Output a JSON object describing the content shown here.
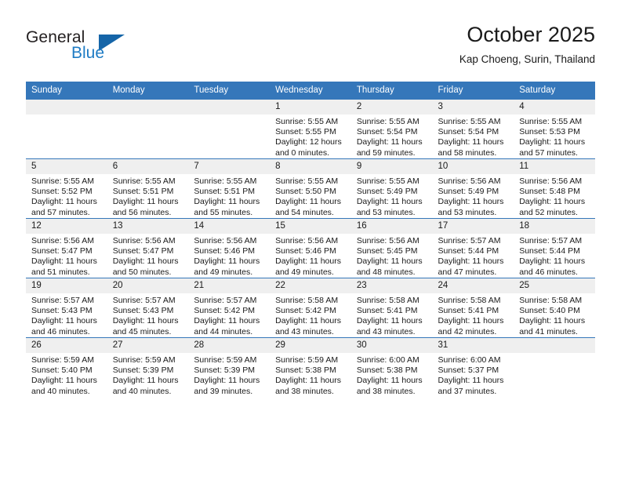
{
  "brand": {
    "name_top": "General",
    "name_bottom": "Blue",
    "accent_color": "#1e7bc4",
    "triangle_color": "#1565a8"
  },
  "header": {
    "month_title": "October 2025",
    "location": "Kap Choeng, Surin, Thailand"
  },
  "calendar": {
    "header_bg": "#3577ba",
    "daynum_bg": "#efefef",
    "weekday_headers": [
      "Sunday",
      "Monday",
      "Tuesday",
      "Wednesday",
      "Thursday",
      "Friday",
      "Saturday"
    ],
    "weeks": [
      [
        {
          "day": "",
          "empty": true,
          "sunrise": "",
          "sunset": "",
          "daylight_line1": "",
          "daylight_line2": ""
        },
        {
          "day": "",
          "empty": true,
          "sunrise": "",
          "sunset": "",
          "daylight_line1": "",
          "daylight_line2": ""
        },
        {
          "day": "",
          "empty": true,
          "sunrise": "",
          "sunset": "",
          "daylight_line1": "",
          "daylight_line2": ""
        },
        {
          "day": "1",
          "empty": false,
          "sunrise": "Sunrise: 5:55 AM",
          "sunset": "Sunset: 5:55 PM",
          "daylight_line1": "Daylight: 12 hours",
          "daylight_line2": "and 0 minutes."
        },
        {
          "day": "2",
          "empty": false,
          "sunrise": "Sunrise: 5:55 AM",
          "sunset": "Sunset: 5:54 PM",
          "daylight_line1": "Daylight: 11 hours",
          "daylight_line2": "and 59 minutes."
        },
        {
          "day": "3",
          "empty": false,
          "sunrise": "Sunrise: 5:55 AM",
          "sunset": "Sunset: 5:54 PM",
          "daylight_line1": "Daylight: 11 hours",
          "daylight_line2": "and 58 minutes."
        },
        {
          "day": "4",
          "empty": false,
          "sunrise": "Sunrise: 5:55 AM",
          "sunset": "Sunset: 5:53 PM",
          "daylight_line1": "Daylight: 11 hours",
          "daylight_line2": "and 57 minutes."
        }
      ],
      [
        {
          "day": "5",
          "empty": false,
          "sunrise": "Sunrise: 5:55 AM",
          "sunset": "Sunset: 5:52 PM",
          "daylight_line1": "Daylight: 11 hours",
          "daylight_line2": "and 57 minutes."
        },
        {
          "day": "6",
          "empty": false,
          "sunrise": "Sunrise: 5:55 AM",
          "sunset": "Sunset: 5:51 PM",
          "daylight_line1": "Daylight: 11 hours",
          "daylight_line2": "and 56 minutes."
        },
        {
          "day": "7",
          "empty": false,
          "sunrise": "Sunrise: 5:55 AM",
          "sunset": "Sunset: 5:51 PM",
          "daylight_line1": "Daylight: 11 hours",
          "daylight_line2": "and 55 minutes."
        },
        {
          "day": "8",
          "empty": false,
          "sunrise": "Sunrise: 5:55 AM",
          "sunset": "Sunset: 5:50 PM",
          "daylight_line1": "Daylight: 11 hours",
          "daylight_line2": "and 54 minutes."
        },
        {
          "day": "9",
          "empty": false,
          "sunrise": "Sunrise: 5:55 AM",
          "sunset": "Sunset: 5:49 PM",
          "daylight_line1": "Daylight: 11 hours",
          "daylight_line2": "and 53 minutes."
        },
        {
          "day": "10",
          "empty": false,
          "sunrise": "Sunrise: 5:56 AM",
          "sunset": "Sunset: 5:49 PM",
          "daylight_line1": "Daylight: 11 hours",
          "daylight_line2": "and 53 minutes."
        },
        {
          "day": "11",
          "empty": false,
          "sunrise": "Sunrise: 5:56 AM",
          "sunset": "Sunset: 5:48 PM",
          "daylight_line1": "Daylight: 11 hours",
          "daylight_line2": "and 52 minutes."
        }
      ],
      [
        {
          "day": "12",
          "empty": false,
          "sunrise": "Sunrise: 5:56 AM",
          "sunset": "Sunset: 5:47 PM",
          "daylight_line1": "Daylight: 11 hours",
          "daylight_line2": "and 51 minutes."
        },
        {
          "day": "13",
          "empty": false,
          "sunrise": "Sunrise: 5:56 AM",
          "sunset": "Sunset: 5:47 PM",
          "daylight_line1": "Daylight: 11 hours",
          "daylight_line2": "and 50 minutes."
        },
        {
          "day": "14",
          "empty": false,
          "sunrise": "Sunrise: 5:56 AM",
          "sunset": "Sunset: 5:46 PM",
          "daylight_line1": "Daylight: 11 hours",
          "daylight_line2": "and 49 minutes."
        },
        {
          "day": "15",
          "empty": false,
          "sunrise": "Sunrise: 5:56 AM",
          "sunset": "Sunset: 5:46 PM",
          "daylight_line1": "Daylight: 11 hours",
          "daylight_line2": "and 49 minutes."
        },
        {
          "day": "16",
          "empty": false,
          "sunrise": "Sunrise: 5:56 AM",
          "sunset": "Sunset: 5:45 PM",
          "daylight_line1": "Daylight: 11 hours",
          "daylight_line2": "and 48 minutes."
        },
        {
          "day": "17",
          "empty": false,
          "sunrise": "Sunrise: 5:57 AM",
          "sunset": "Sunset: 5:44 PM",
          "daylight_line1": "Daylight: 11 hours",
          "daylight_line2": "and 47 minutes."
        },
        {
          "day": "18",
          "empty": false,
          "sunrise": "Sunrise: 5:57 AM",
          "sunset": "Sunset: 5:44 PM",
          "daylight_line1": "Daylight: 11 hours",
          "daylight_line2": "and 46 minutes."
        }
      ],
      [
        {
          "day": "19",
          "empty": false,
          "sunrise": "Sunrise: 5:57 AM",
          "sunset": "Sunset: 5:43 PM",
          "daylight_line1": "Daylight: 11 hours",
          "daylight_line2": "and 46 minutes."
        },
        {
          "day": "20",
          "empty": false,
          "sunrise": "Sunrise: 5:57 AM",
          "sunset": "Sunset: 5:43 PM",
          "daylight_line1": "Daylight: 11 hours",
          "daylight_line2": "and 45 minutes."
        },
        {
          "day": "21",
          "empty": false,
          "sunrise": "Sunrise: 5:57 AM",
          "sunset": "Sunset: 5:42 PM",
          "daylight_line1": "Daylight: 11 hours",
          "daylight_line2": "and 44 minutes."
        },
        {
          "day": "22",
          "empty": false,
          "sunrise": "Sunrise: 5:58 AM",
          "sunset": "Sunset: 5:42 PM",
          "daylight_line1": "Daylight: 11 hours",
          "daylight_line2": "and 43 minutes."
        },
        {
          "day": "23",
          "empty": false,
          "sunrise": "Sunrise: 5:58 AM",
          "sunset": "Sunset: 5:41 PM",
          "daylight_line1": "Daylight: 11 hours",
          "daylight_line2": "and 43 minutes."
        },
        {
          "day": "24",
          "empty": false,
          "sunrise": "Sunrise: 5:58 AM",
          "sunset": "Sunset: 5:41 PM",
          "daylight_line1": "Daylight: 11 hours",
          "daylight_line2": "and 42 minutes."
        },
        {
          "day": "25",
          "empty": false,
          "sunrise": "Sunrise: 5:58 AM",
          "sunset": "Sunset: 5:40 PM",
          "daylight_line1": "Daylight: 11 hours",
          "daylight_line2": "and 41 minutes."
        }
      ],
      [
        {
          "day": "26",
          "empty": false,
          "sunrise": "Sunrise: 5:59 AM",
          "sunset": "Sunset: 5:40 PM",
          "daylight_line1": "Daylight: 11 hours",
          "daylight_line2": "and 40 minutes."
        },
        {
          "day": "27",
          "empty": false,
          "sunrise": "Sunrise: 5:59 AM",
          "sunset": "Sunset: 5:39 PM",
          "daylight_line1": "Daylight: 11 hours",
          "daylight_line2": "and 40 minutes."
        },
        {
          "day": "28",
          "empty": false,
          "sunrise": "Sunrise: 5:59 AM",
          "sunset": "Sunset: 5:39 PM",
          "daylight_line1": "Daylight: 11 hours",
          "daylight_line2": "and 39 minutes."
        },
        {
          "day": "29",
          "empty": false,
          "sunrise": "Sunrise: 5:59 AM",
          "sunset": "Sunset: 5:38 PM",
          "daylight_line1": "Daylight: 11 hours",
          "daylight_line2": "and 38 minutes."
        },
        {
          "day": "30",
          "empty": false,
          "sunrise": "Sunrise: 6:00 AM",
          "sunset": "Sunset: 5:38 PM",
          "daylight_line1": "Daylight: 11 hours",
          "daylight_line2": "and 38 minutes."
        },
        {
          "day": "31",
          "empty": false,
          "sunrise": "Sunrise: 6:00 AM",
          "sunset": "Sunset: 5:37 PM",
          "daylight_line1": "Daylight: 11 hours",
          "daylight_line2": "and 37 minutes."
        },
        {
          "day": "",
          "empty": true,
          "sunrise": "",
          "sunset": "",
          "daylight_line1": "",
          "daylight_line2": ""
        }
      ]
    ]
  }
}
